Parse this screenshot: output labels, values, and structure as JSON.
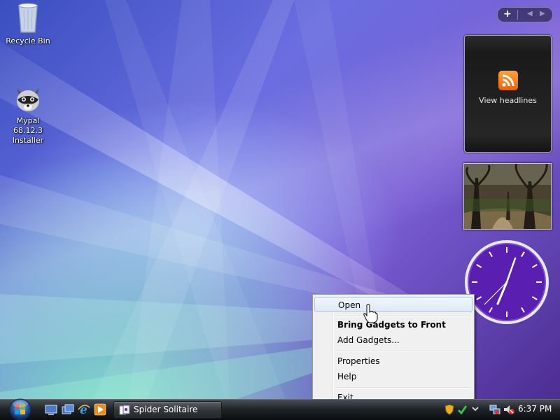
{
  "desktop_icons": [
    {
      "label": "Recycle Bin",
      "icon": "recycle-bin-icon"
    },
    {
      "label_line1": "Mypal 68.12.3",
      "label_line2": "Installer",
      "icon": "raccoon-installer-icon"
    }
  ],
  "sidebar": {
    "add_button": "+",
    "feed_gadget": {
      "label": "View headlines",
      "icon": "rss-icon"
    },
    "slideshow_gadget": {
      "icon": "forest-photo"
    },
    "clock_gadget": {
      "hour": 7,
      "minute": 37,
      "icon": "clock-icon",
      "face_color": "#5a1fb0"
    }
  },
  "context_menu": {
    "items": [
      {
        "label": "Open",
        "highlighted": true
      },
      {
        "label": "Bring Gadgets to Front",
        "bold": true
      },
      {
        "label": "Add Gadgets..."
      },
      {
        "label": "Properties"
      },
      {
        "label": "Help"
      },
      {
        "label": "Exit"
      }
    ]
  },
  "taskbar": {
    "start_icon": "windows-orb-icon",
    "quick_launch": [
      "show-desktop-icon",
      "switch-windows-icon",
      "internet-explorer-icon",
      "media-player-icon"
    ],
    "tasks": [
      {
        "label": "Spider Solitaire",
        "icon": "spider-solitaire-icon"
      }
    ],
    "tray_icons": [
      "shield-icon",
      "security-check-icon",
      "chevron-icon",
      "network-icon",
      "volume-muted-icon"
    ],
    "clock": "6:37 PM"
  }
}
